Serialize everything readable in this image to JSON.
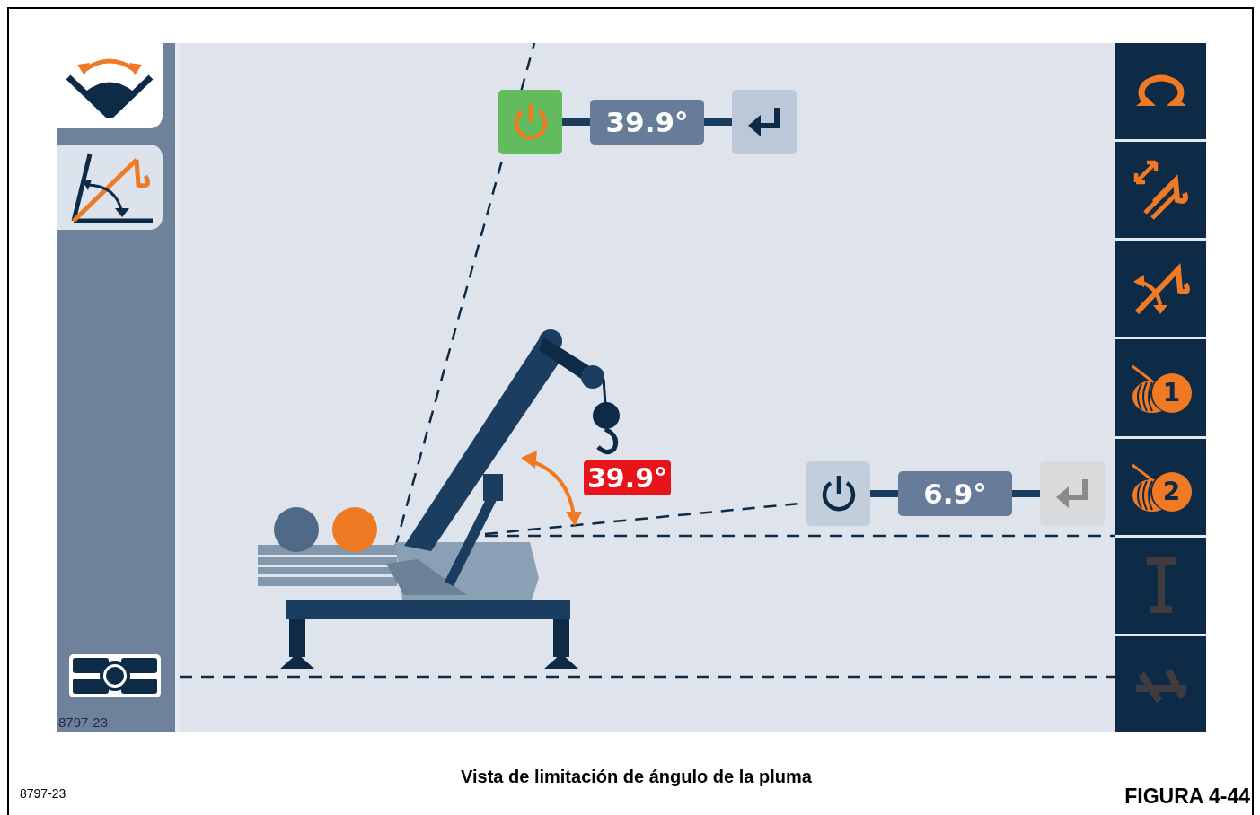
{
  "left_sidebar": {
    "items": [
      {
        "kind": "swing",
        "selected": true
      },
      {
        "kind": "boom_angle",
        "selected": false
      }
    ],
    "image_code": "8797-23"
  },
  "upper_limit": {
    "enabled": true,
    "value": "39.9°",
    "enter_disabled": false
  },
  "lower_limit": {
    "enabled": false,
    "value": "6.9°",
    "enter_disabled": true
  },
  "boom_angle_readout": "39.9°",
  "right_toolbar": [
    {
      "kind": "swing",
      "disabled": false
    },
    {
      "kind": "telescope",
      "disabled": false
    },
    {
      "kind": "boom",
      "disabled": false
    },
    {
      "kind": "winch",
      "label": "1",
      "disabled": false
    },
    {
      "kind": "winch",
      "label": "2",
      "disabled": false
    },
    {
      "kind": "height",
      "disabled": true
    },
    {
      "kind": "radius",
      "disabled": true
    }
  ],
  "caption": "Vista de limitación de ángulo de la pluma",
  "figure_code": "8797-23",
  "figure_label": "FIGURA 4-44"
}
